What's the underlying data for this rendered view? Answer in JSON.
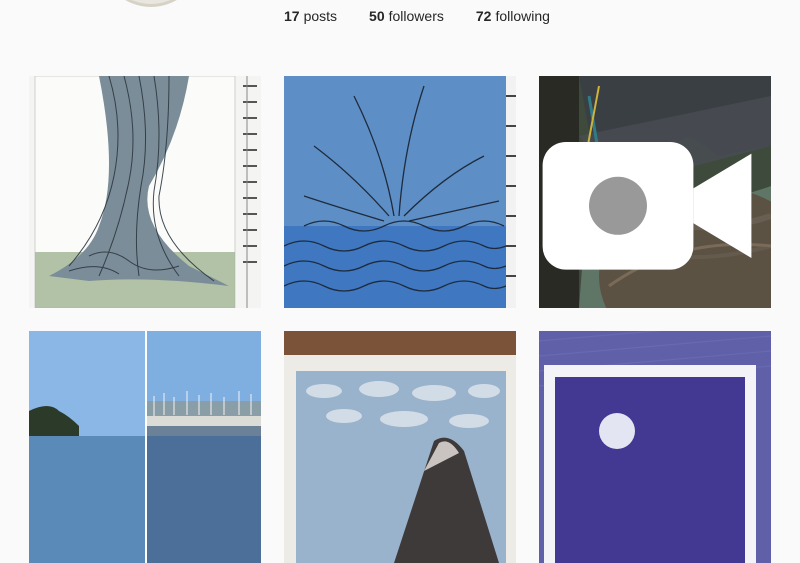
{
  "profile": {
    "stats": [
      {
        "count": "17",
        "label": "posts"
      },
      {
        "count": "50",
        "label": "followers"
      },
      {
        "count": "72",
        "label": "following"
      }
    ]
  },
  "posts": [
    {
      "kind": "drawing-hair-tree"
    },
    {
      "kind": "watercolor-blue-leaves"
    },
    {
      "kind": "boat-wake-photo",
      "media_icon": "video-camera-icon"
    },
    {
      "kind": "marina-panorama-photo"
    },
    {
      "kind": "watercolor-sky-mountain"
    },
    {
      "kind": "watercolor-night-moon"
    }
  ]
}
